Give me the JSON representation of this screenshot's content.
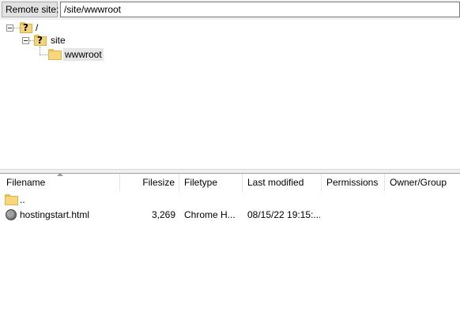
{
  "remote_site": {
    "label": "Remote site:",
    "path": "/site/wwwroot"
  },
  "tree": {
    "nodes": [
      {
        "label": "/",
        "icon": "unknown-folder-icon"
      },
      {
        "label": "site",
        "icon": "unknown-folder-icon"
      },
      {
        "label": "wwwroot",
        "icon": "folder-icon",
        "selected": true
      }
    ]
  },
  "file_list": {
    "columns": [
      "Filename",
      "Filesize",
      "Filetype",
      "Last modified",
      "Permissions",
      "Owner/Group"
    ],
    "sorted_by": "Filename",
    "rows": [
      {
        "name": "..",
        "icon": "folder-icon",
        "size": "",
        "type": "",
        "modified": "",
        "permissions": "",
        "owner": ""
      },
      {
        "name": "hostingstart.html",
        "icon": "html-file-icon",
        "size": "3,269",
        "type": "Chrome H...",
        "modified": "08/15/22 19:15:...",
        "permissions": "",
        "owner": ""
      }
    ]
  },
  "colors": {
    "folder": "#f6d77e",
    "toolbar_bg": "#f0f0f0",
    "selected_bg": "#e5e5e5"
  }
}
